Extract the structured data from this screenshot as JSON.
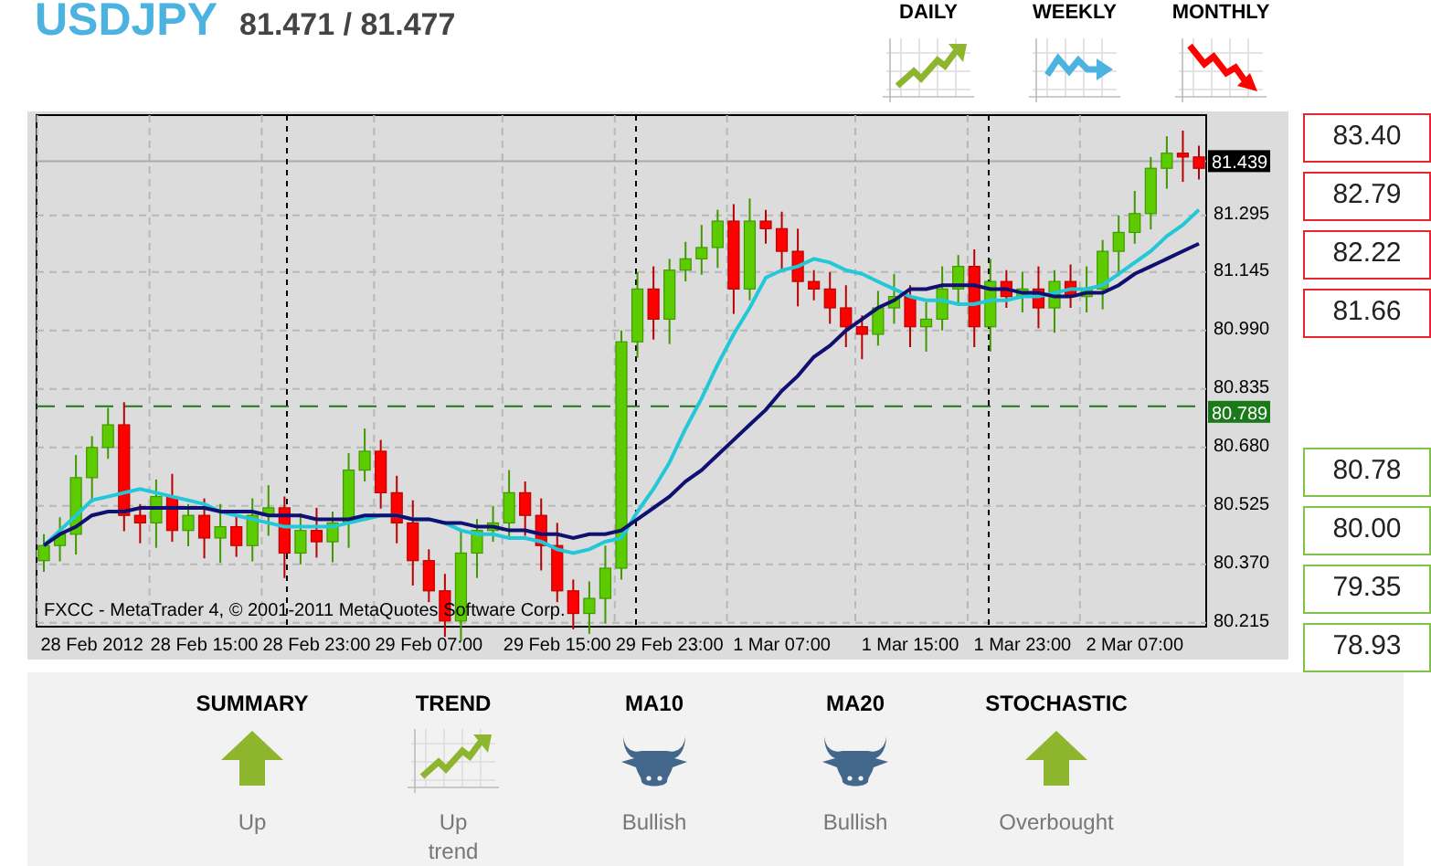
{
  "header": {
    "symbol": "USDJPY",
    "quote": "81.471 / 81.477"
  },
  "timeframes": [
    {
      "label": "DAILY",
      "kind": "up"
    },
    {
      "label": "WEEKLY",
      "kind": "sideways"
    },
    {
      "label": "MONTHLY",
      "kind": "down"
    }
  ],
  "chart": {
    "caption": "FXCC - MetaTrader 4, © 2001-2011 MetaQuotes Software Corp.",
    "chart_data": {
      "type": "candlestick",
      "grid": true,
      "categories": [
        null,
        null,
        null,
        "28 Feb 2012",
        null,
        null,
        null,
        null,
        null,
        null,
        "28 Feb 15:00",
        null,
        null,
        null,
        null,
        null,
        null,
        "28 Feb 23:00",
        null,
        null,
        null,
        null,
        null,
        null,
        "29 Feb 07:00",
        null,
        null,
        null,
        null,
        null,
        null,
        null,
        "29 Feb 15:00",
        null,
        null,
        null,
        null,
        null,
        null,
        "29 Feb 23:00",
        null,
        null,
        null,
        null,
        null,
        null,
        "1 Mar 07:00",
        null,
        null,
        null,
        null,
        null,
        null,
        null,
        "1 Mar 15:00",
        null,
        null,
        null,
        null,
        null,
        null,
        "1 Mar 23:00",
        null,
        null,
        null,
        null,
        null,
        null,
        "2 Mar 07:00",
        null,
        null,
        null,
        null
      ],
      "ref_lines": [
        {
          "axis": "y",
          "value": 81.439,
          "label": "81.439",
          "color": "#aaaaaa"
        },
        {
          "axis": "y",
          "value": 80.789,
          "label": "80.789",
          "color": "#1a7a1a"
        }
      ],
      "ohlc": [
        [
          80.38,
          80.45,
          80.35,
          80.42
        ],
        [
          80.42,
          80.495,
          80.378,
          80.45
        ],
        [
          80.45,
          80.66,
          80.396,
          80.6
        ],
        [
          80.6,
          80.71,
          80.534,
          80.68
        ],
        [
          80.68,
          80.785,
          80.65,
          80.74
        ],
        [
          80.74,
          80.8,
          80.458,
          80.5
        ],
        [
          80.5,
          80.53,
          80.426,
          80.48
        ],
        [
          80.48,
          80.595,
          80.414,
          80.55
        ],
        [
          80.55,
          80.61,
          80.43,
          80.46
        ],
        [
          80.46,
          80.53,
          80.418,
          80.5
        ],
        [
          80.5,
          80.545,
          80.386,
          80.44
        ],
        [
          80.44,
          80.53,
          80.374,
          80.47
        ],
        [
          80.47,
          80.5,
          80.39,
          80.42
        ],
        [
          80.42,
          80.545,
          80.378,
          80.5
        ],
        [
          80.5,
          80.58,
          80.446,
          80.52
        ],
        [
          80.52,
          80.55,
          80.334,
          80.4
        ],
        [
          80.4,
          80.505,
          80.37,
          80.46
        ],
        [
          80.46,
          80.52,
          80.388,
          80.43
        ],
        [
          80.43,
          80.51,
          80.376,
          80.48
        ],
        [
          80.48,
          80.665,
          80.414,
          80.62
        ],
        [
          80.62,
          80.73,
          80.59,
          80.67
        ],
        [
          80.67,
          80.7,
          80.518,
          80.56
        ],
        [
          80.56,
          80.605,
          80.426,
          80.48
        ],
        [
          80.48,
          80.54,
          80.314,
          80.38
        ],
        [
          80.38,
          80.41,
          80.27,
          80.3
        ],
        [
          80.3,
          80.345,
          80.178,
          80.22
        ],
        [
          80.22,
          80.46,
          80.166,
          80.4
        ],
        [
          80.4,
          80.49,
          80.334,
          80.46
        ],
        [
          80.46,
          80.525,
          80.43,
          80.48
        ],
        [
          80.48,
          80.62,
          80.438,
          80.56
        ],
        [
          80.56,
          80.59,
          80.446,
          80.5
        ],
        [
          80.5,
          80.545,
          80.354,
          80.42
        ],
        [
          80.42,
          80.48,
          80.27,
          80.3
        ],
        [
          80.3,
          80.33,
          80.198,
          80.24
        ],
        [
          80.24,
          80.325,
          80.186,
          80.28
        ],
        [
          80.28,
          80.42,
          80.214,
          80.36
        ],
        [
          80.36,
          80.99,
          80.33,
          80.96
        ],
        [
          80.96,
          81.145,
          80.918,
          81.1
        ],
        [
          81.1,
          81.16,
          80.966,
          81.02
        ],
        [
          81.02,
          81.18,
          80.954,
          81.15
        ],
        [
          81.15,
          81.225,
          81.12,
          81.18
        ],
        [
          81.18,
          81.27,
          81.138,
          81.21
        ],
        [
          81.21,
          81.31,
          81.156,
          81.28
        ],
        [
          81.28,
          81.325,
          81.034,
          81.1
        ],
        [
          81.1,
          81.34,
          81.07,
          81.28
        ],
        [
          81.28,
          81.31,
          81.22,
          81.26
        ],
        [
          81.26,
          81.305,
          81.146,
          81.2
        ],
        [
          81.2,
          81.26,
          81.054,
          81.12
        ],
        [
          81.12,
          81.15,
          81.07,
          81.1
        ],
        [
          81.1,
          81.145,
          81.008,
          81.05
        ],
        [
          81.05,
          81.11,
          80.946,
          81.0
        ],
        [
          81.0,
          81.03,
          80.914,
          80.98
        ],
        [
          80.98,
          81.095,
          80.95,
          81.05
        ],
        [
          81.05,
          81.14,
          81.008,
          81.08
        ],
        [
          81.08,
          81.11,
          80.946,
          81.0
        ],
        [
          81.0,
          81.065,
          80.934,
          81.02
        ],
        [
          81.02,
          81.16,
          80.99,
          81.1
        ],
        [
          81.1,
          81.19,
          81.058,
          81.16
        ],
        [
          81.16,
          81.205,
          80.946,
          81.0
        ],
        [
          81.0,
          81.18,
          80.934,
          81.12
        ],
        [
          81.12,
          81.15,
          81.05,
          81.08
        ],
        [
          81.08,
          81.145,
          81.038,
          81.1
        ],
        [
          81.1,
          81.16,
          80.996,
          81.05
        ],
        [
          81.05,
          81.15,
          80.984,
          81.12
        ],
        [
          81.12,
          81.165,
          81.05,
          81.08
        ],
        [
          81.08,
          81.16,
          81.038,
          81.1
        ],
        [
          81.1,
          81.23,
          81.046,
          81.2
        ],
        [
          81.2,
          81.295,
          81.134,
          81.25
        ],
        [
          81.25,
          81.36,
          81.22,
          81.3
        ],
        [
          81.3,
          81.45,
          81.258,
          81.42
        ],
        [
          81.42,
          81.505,
          81.366,
          81.46
        ],
        [
          81.46,
          81.52,
          81.384,
          81.45
        ],
        [
          81.45,
          81.48,
          81.39,
          81.42
        ]
      ],
      "series": [
        {
          "type": "line",
          "color": "#22c8d8",
          "values": [
            80.42,
            80.46,
            80.5,
            80.54,
            80.55,
            80.56,
            80.57,
            80.56,
            80.55,
            80.54,
            80.53,
            80.51,
            80.5,
            80.49,
            80.48,
            80.47,
            80.47,
            80.47,
            80.47,
            80.48,
            80.49,
            80.5,
            80.5,
            80.49,
            80.49,
            80.48,
            80.46,
            80.45,
            80.45,
            80.44,
            80.44,
            80.43,
            80.41,
            80.4,
            80.41,
            80.43,
            80.44,
            80.51,
            80.57,
            80.64,
            80.73,
            80.81,
            80.9,
            80.98,
            81.05,
            81.13,
            81.15,
            81.16,
            81.18,
            81.17,
            81.15,
            81.14,
            81.12,
            81.1,
            81.08,
            81.07,
            81.07,
            81.06,
            81.06,
            81.07,
            81.07,
            81.08,
            81.08,
            81.09,
            81.1,
            81.1,
            81.11,
            81.14,
            81.17,
            81.2,
            81.24,
            81.27,
            81.31
          ]
        },
        {
          "type": "line",
          "color": "#101070",
          "values": [
            80.42,
            80.45,
            80.47,
            80.5,
            80.51,
            80.51,
            80.52,
            80.52,
            80.52,
            80.52,
            80.52,
            80.51,
            80.51,
            80.51,
            80.5,
            80.5,
            80.5,
            80.49,
            80.49,
            80.49,
            80.5,
            80.5,
            80.5,
            80.49,
            80.49,
            80.48,
            80.48,
            80.47,
            80.47,
            80.46,
            80.46,
            80.45,
            80.45,
            80.44,
            80.45,
            80.45,
            80.46,
            80.49,
            80.52,
            80.55,
            80.59,
            80.62,
            80.66,
            80.7,
            80.74,
            80.78,
            80.83,
            80.87,
            80.92,
            80.95,
            80.99,
            81.02,
            81.05,
            81.07,
            81.1,
            81.1,
            81.11,
            81.11,
            81.11,
            81.1,
            81.1,
            81.09,
            81.09,
            81.08,
            81.08,
            81.09,
            81.09,
            81.11,
            81.14,
            81.16,
            81.18,
            81.2,
            81.22
          ]
        }
      ],
      "ylim": [
        80.205,
        81.561
      ],
      "yticks": [
        {
          "value": 81.295,
          "label": "81.295"
        },
        {
          "value": 81.145,
          "label": "81.145"
        },
        {
          "value": 80.99,
          "label": "80.990"
        },
        {
          "value": 80.835,
          "label": "80.835"
        },
        {
          "value": 80.68,
          "label": "80.680"
        },
        {
          "value": 80.525,
          "label": "80.525"
        },
        {
          "value": 80.37,
          "label": "80.370"
        },
        {
          "value": 80.215,
          "label": "80.215"
        }
      ]
    }
  },
  "levels": [
    {
      "value": "83.40",
      "kind": "resistance"
    },
    {
      "value": "82.79",
      "kind": "resistance"
    },
    {
      "value": "82.22",
      "kind": "resistance"
    },
    {
      "value": "81.66",
      "kind": "resistance"
    },
    {
      "value": "80.78",
      "kind": "support"
    },
    {
      "value": "80.00",
      "kind": "support"
    },
    {
      "value": "79.35",
      "kind": "support"
    },
    {
      "value": "78.93",
      "kind": "support"
    }
  ],
  "indicators": [
    {
      "title": "SUMMARY",
      "kind": "arrow",
      "value": "Up"
    },
    {
      "title": "TREND",
      "kind": "trend",
      "value": "Up trend"
    },
    {
      "title": "MA10",
      "kind": "bull",
      "value": "Bullish"
    },
    {
      "title": "MA20",
      "kind": "bull",
      "value": "Bullish"
    },
    {
      "title": "STOCHASTIC",
      "kind": "arrow",
      "value": "Overbought"
    }
  ]
}
